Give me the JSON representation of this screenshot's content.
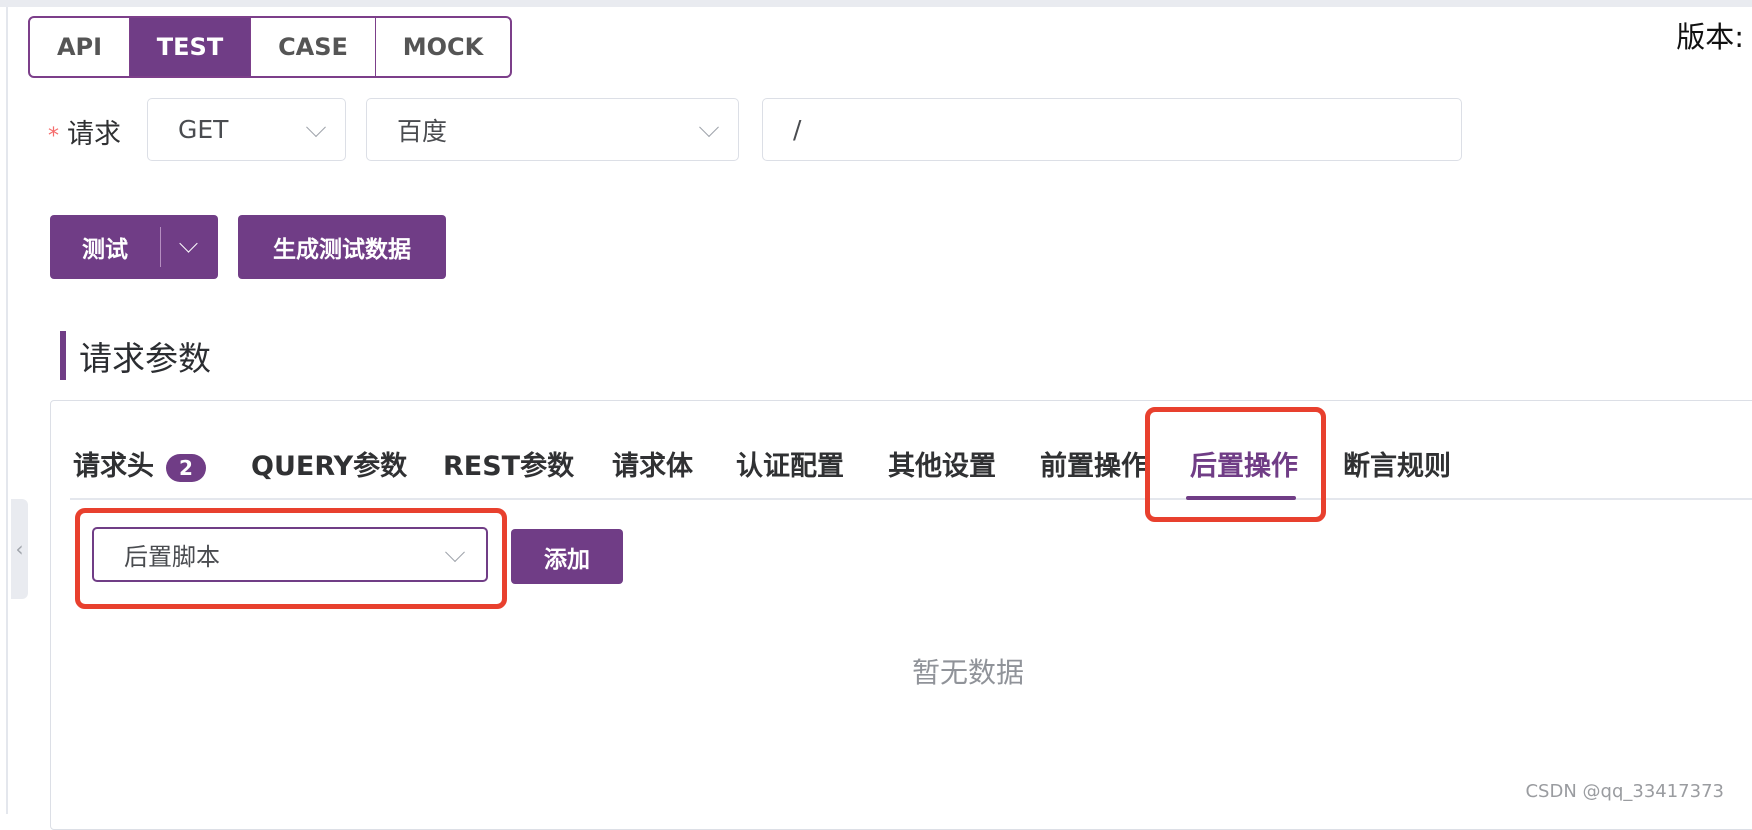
{
  "mode_tabs": [
    {
      "label": "API",
      "active": false
    },
    {
      "label": "TEST",
      "active": true
    },
    {
      "label": "CASE",
      "active": false
    },
    {
      "label": "MOCK",
      "active": false
    }
  ],
  "version_label": "版本:",
  "request": {
    "required_star": "*",
    "label": "请求",
    "method": "GET",
    "environment": "百度",
    "path": "/"
  },
  "buttons": {
    "test": "测试",
    "generate": "生成测试数据",
    "add": "添加"
  },
  "section_title": "请求参数",
  "param_tabs": [
    {
      "label": "请求头",
      "badge": "2"
    },
    {
      "label": "QUERY参数"
    },
    {
      "label": "REST参数"
    },
    {
      "label": "请求体"
    },
    {
      "label": "认证配置"
    },
    {
      "label": "其他设置"
    },
    {
      "label": "前置操作"
    },
    {
      "label": "后置操作",
      "active": true
    },
    {
      "label": "断言规则"
    }
  ],
  "post_action": {
    "selected": "后置脚本"
  },
  "empty_text": "暂无数据",
  "watermark": "CSDN @qq_33417373",
  "colors": {
    "accent": "#703d86",
    "highlight": "#e8402e",
    "required": "#f56c6c"
  }
}
